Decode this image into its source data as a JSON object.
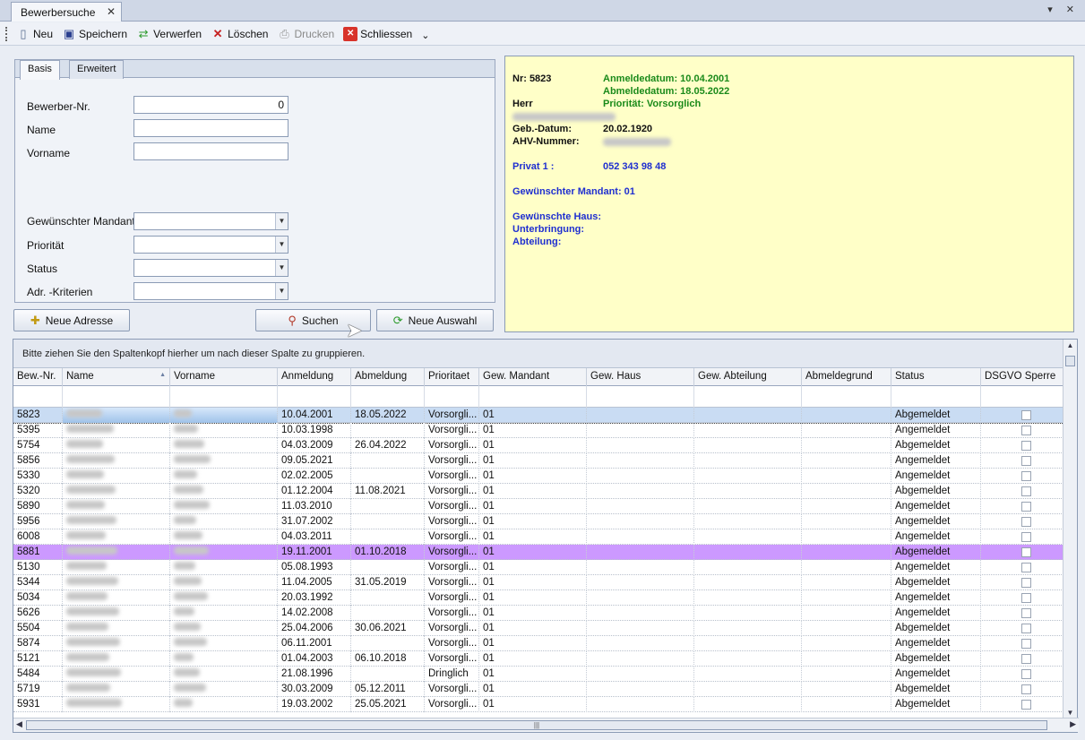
{
  "window": {
    "tab_title": "Bewerbersuche",
    "tab_close": "✕",
    "controls": "▾ ✕"
  },
  "toolbar": {
    "new": "Neu",
    "save": "Speichern",
    "discard": "Verwerfen",
    "delete": "Löschen",
    "print": "Drucken",
    "close": "Schliessen",
    "overflow": "⌄"
  },
  "search_tabs": {
    "basis": "Basis",
    "erweitert": "Erweitert"
  },
  "form": {
    "bewerber_nr_label": "Bewerber-Nr.",
    "bewerber_nr_value": "0",
    "name_label": "Name",
    "vorname_label": "Vorname",
    "mandant_label": "Gewünschter Mandant",
    "prioritaet_label": "Priorität",
    "status_label": "Status",
    "adr_label": "Adr. -Kriterien"
  },
  "buttons": {
    "neue_adresse": "Neue Adresse",
    "suchen": "Suchen",
    "neue_auswahl": "Neue Auswahl"
  },
  "info": {
    "nr": "Nr: 5823",
    "anmeldedatum": "Anmeldedatum: 10.04.2001",
    "abmeldedatum": "Abmeldedatum: 18.05.2022",
    "anrede": "Herr",
    "prioritaet": "Priorität: Vorsorglich",
    "geb_label": "Geb.-Datum:",
    "geb_value": "20.02.1920",
    "ahv_label": "AHV-Nummer:",
    "privat_label": "Privat 1 :",
    "privat_value": "052 343 98 48",
    "mandant": "Gewünschter Mandant: 01",
    "haus": "Gewünschte Haus:",
    "unterbringung": "Unterbringung:",
    "abteilung": "Abteilung:"
  },
  "grid": {
    "group_hint": "Bitte ziehen Sie den Spaltenkopf hierher um nach dieser Spalte zu gruppieren.",
    "columns": [
      "Bew.-Nr.",
      "Name",
      "Vorname",
      "Anmeldung",
      "Abmeldung",
      "Prioritaet",
      "Gew. Mandant",
      "Gew. Haus",
      "Gew. Abteilung",
      "Abmeldegrund",
      "Status",
      "DSGVO Sperre"
    ],
    "rows": [
      {
        "nr": "5823",
        "an": "10.04.2001",
        "ab": "18.05.2022",
        "prio": "Vorsorgli...",
        "mandant": "01",
        "status": "Abgemeldet",
        "state": "selected"
      },
      {
        "nr": "5395",
        "an": "10.03.1998",
        "ab": "",
        "prio": "Vorsorgli...",
        "mandant": "01",
        "status": "Angemeldet",
        "state": ""
      },
      {
        "nr": "5754",
        "an": "04.03.2009",
        "ab": "26.04.2022",
        "prio": "Vorsorgli...",
        "mandant": "01",
        "status": "Abgemeldet",
        "state": ""
      },
      {
        "nr": "5856",
        "an": "09.05.2021",
        "ab": "",
        "prio": "Vorsorgli...",
        "mandant": "01",
        "status": "Angemeldet",
        "state": ""
      },
      {
        "nr": "5330",
        "an": "02.02.2005",
        "ab": "",
        "prio": "Vorsorgli...",
        "mandant": "01",
        "status": "Angemeldet",
        "state": ""
      },
      {
        "nr": "5320",
        "an": "01.12.2004",
        "ab": "11.08.2021",
        "prio": "Vorsorgli...",
        "mandant": "01",
        "status": "Abgemeldet",
        "state": ""
      },
      {
        "nr": "5890",
        "an": "11.03.2010",
        "ab": "",
        "prio": "Vorsorgli...",
        "mandant": "01",
        "status": "Angemeldet",
        "state": ""
      },
      {
        "nr": "5956",
        "an": "31.07.2002",
        "ab": "",
        "prio": "Vorsorgli...",
        "mandant": "01",
        "status": "Angemeldet",
        "state": ""
      },
      {
        "nr": "6008",
        "an": "04.03.2011",
        "ab": "",
        "prio": "Vorsorgli...",
        "mandant": "01",
        "status": "Angemeldet",
        "state": ""
      },
      {
        "nr": "5881",
        "an": "19.11.2001",
        "ab": "01.10.2018",
        "prio": "Vorsorgli...",
        "mandant": "01",
        "status": "Abgemeldet",
        "state": "purple"
      },
      {
        "nr": "5130",
        "an": "05.08.1993",
        "ab": "",
        "prio": "Vorsorgli...",
        "mandant": "01",
        "status": "Angemeldet",
        "state": ""
      },
      {
        "nr": "5344",
        "an": "11.04.2005",
        "ab": "31.05.2019",
        "prio": "Vorsorgli...",
        "mandant": "01",
        "status": "Abgemeldet",
        "state": ""
      },
      {
        "nr": "5034",
        "an": "20.03.1992",
        "ab": "",
        "prio": "Vorsorgli...",
        "mandant": "01",
        "status": "Angemeldet",
        "state": ""
      },
      {
        "nr": "5626",
        "an": "14.02.2008",
        "ab": "",
        "prio": "Vorsorgli...",
        "mandant": "01",
        "status": "Angemeldet",
        "state": ""
      },
      {
        "nr": "5504",
        "an": "25.04.2006",
        "ab": "30.06.2021",
        "prio": "Vorsorgli...",
        "mandant": "01",
        "status": "Abgemeldet",
        "state": ""
      },
      {
        "nr": "5874",
        "an": "06.11.2001",
        "ab": "",
        "prio": "Vorsorgli...",
        "mandant": "01",
        "status": "Angemeldet",
        "state": ""
      },
      {
        "nr": "5121",
        "an": "01.04.2003",
        "ab": "06.10.2018",
        "prio": "Vorsorgli...",
        "mandant": "01",
        "status": "Abgemeldet",
        "state": ""
      },
      {
        "nr": "5484",
        "an": "21.08.1996",
        "ab": "",
        "prio": "Dringlich",
        "mandant": "01",
        "status": "Angemeldet",
        "state": ""
      },
      {
        "nr": "5719",
        "an": "30.03.2009",
        "ab": "05.12.2011",
        "prio": "Vorsorgli...",
        "mandant": "01",
        "status": "Abgemeldet",
        "state": ""
      },
      {
        "nr": "5931",
        "an": "19.03.2002",
        "ab": "25.05.2021",
        "prio": "Vorsorgli...",
        "mandant": "01",
        "status": "Abgemeldet",
        "state": ""
      }
    ]
  }
}
